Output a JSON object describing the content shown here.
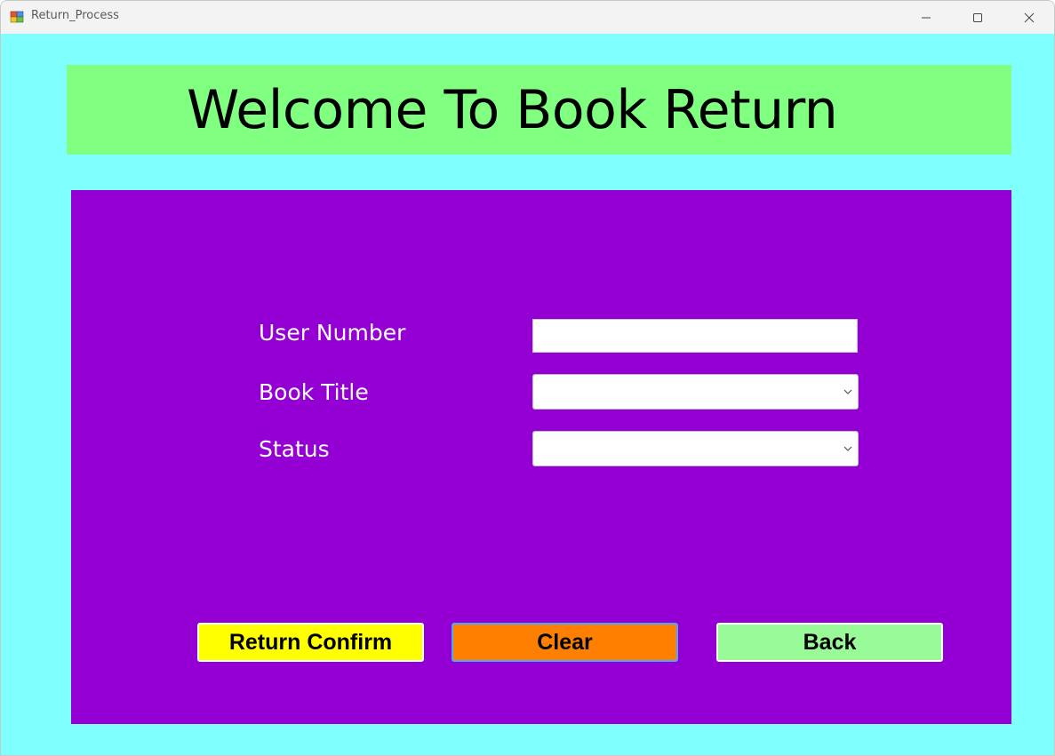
{
  "window": {
    "title": "Return_Process",
    "controls": {
      "minimize_icon": "minimize-icon",
      "maximize_icon": "maximize-icon",
      "close_icon": "close-icon"
    }
  },
  "banner": {
    "title": "Welcome To Book Return",
    "background": "#80ff80"
  },
  "form": {
    "background": "#9400d3",
    "user_number": {
      "label": "User Number",
      "value": ""
    },
    "book_title": {
      "label": "Book Title",
      "selected": ""
    },
    "status": {
      "label": "Status",
      "selected": ""
    }
  },
  "buttons": {
    "return_confirm": {
      "label": "Return Confirm",
      "color": "#ffff00"
    },
    "clear": {
      "label": "Clear",
      "color": "#ff8000"
    },
    "back": {
      "label": "Back",
      "color": "#98fb98"
    }
  },
  "colors": {
    "window_background": "#80ffff",
    "label_text": "#ffffff"
  }
}
